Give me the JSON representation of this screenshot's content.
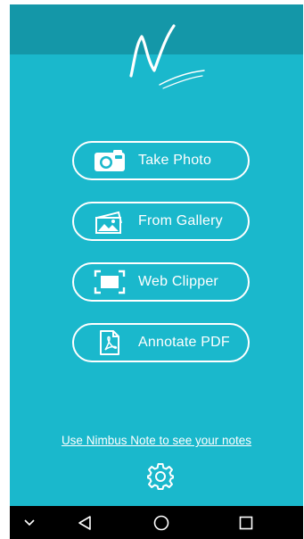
{
  "colors": {
    "background": "#1ab8cc",
    "status_bar": "#1497a8",
    "foreground": "#ffffff",
    "nav_bar": "#000000"
  },
  "logo": {
    "icon": "nimbus-n-logo-icon"
  },
  "actions": [
    {
      "label": "Take Photo",
      "icon": "camera-icon"
    },
    {
      "label": "From Gallery",
      "icon": "gallery-icon"
    },
    {
      "label": "Web Clipper",
      "icon": "web-clipper-icon"
    },
    {
      "label": "Annotate PDF",
      "icon": "pdf-icon"
    }
  ],
  "footer": {
    "link_text": "Use Nimbus Note to see your notes",
    "settings_icon": "gear-icon"
  },
  "nav": {
    "buttons": [
      "chevron-down-icon",
      "back-icon",
      "home-icon",
      "recents-icon"
    ]
  }
}
